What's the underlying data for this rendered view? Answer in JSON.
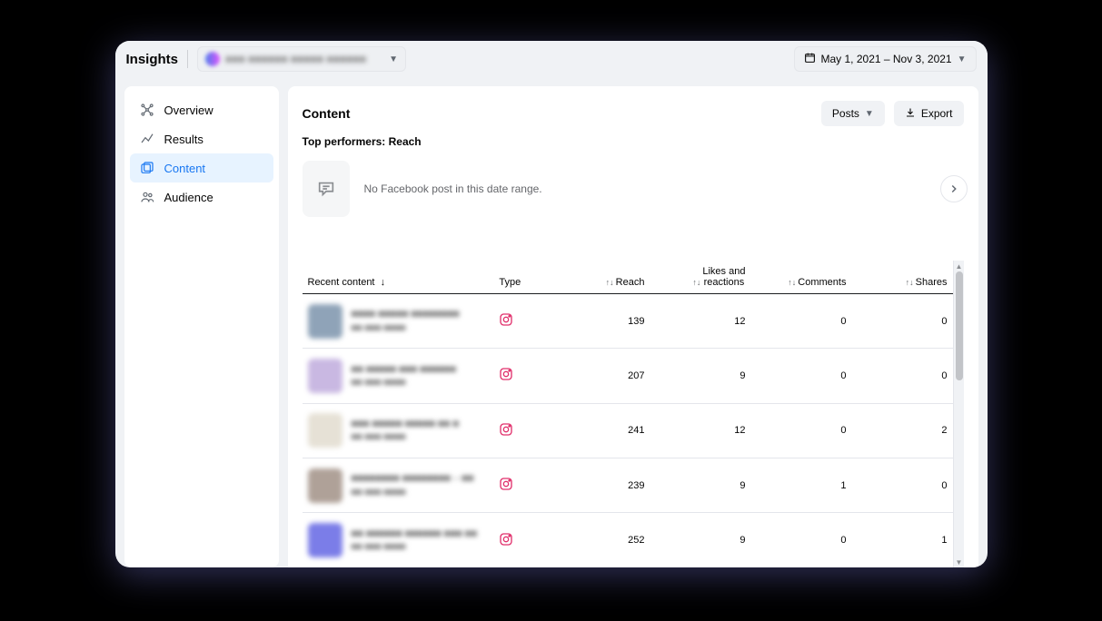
{
  "header": {
    "title": "Insights",
    "page_name_blurred": "■■■ ■■■■■■ ■■■■■ ■■■■■■",
    "date_range": "May 1, 2021 – Nov 3, 2021"
  },
  "sidebar": {
    "items": [
      {
        "label": "Overview",
        "icon": "overview-icon"
      },
      {
        "label": "Results",
        "icon": "results-icon"
      },
      {
        "label": "Content",
        "icon": "content-icon",
        "active": true
      },
      {
        "label": "Audience",
        "icon": "audience-icon"
      }
    ]
  },
  "main": {
    "title": "Content",
    "posts_button": "Posts",
    "export_button": "Export",
    "top_performers_label": "Top performers: Reach",
    "no_post_msg": "No Facebook post in this date range.",
    "columns": {
      "recent": "Recent content",
      "type": "Type",
      "reach": "Reach",
      "likes": "Likes and\nreactions",
      "comments": "Comments",
      "shares": "Shares"
    },
    "rows": [
      {
        "title_blur": "■■■■ ■■■■■ ■■■■■■■■",
        "bg": "#8fa3b8",
        "reach": "139",
        "likes": "12",
        "comments": "0",
        "shares": "0"
      },
      {
        "title_blur": "■■ ■■■■■ ■■■ ■■■■■■",
        "bg": "#c9b8e2",
        "reach": "207",
        "likes": "9",
        "comments": "0",
        "shares": "0"
      },
      {
        "title_blur": "■■■ ■■■■■ ■■■■■ ■■ ■",
        "bg": "#e6e1d6",
        "reach": "241",
        "likes": "12",
        "comments": "0",
        "shares": "2"
      },
      {
        "title_blur": "■■■■■■■■ ■■■■■■■■ – ■■",
        "bg": "#afa198",
        "reach": "239",
        "likes": "9",
        "comments": "1",
        "shares": "0"
      },
      {
        "title_blur": "■■ ■■■■■■ ■■■■■■ ■■■ ■■",
        "bg": "#7b7de8",
        "reach": "252",
        "likes": "9",
        "comments": "0",
        "shares": "1"
      }
    ]
  }
}
